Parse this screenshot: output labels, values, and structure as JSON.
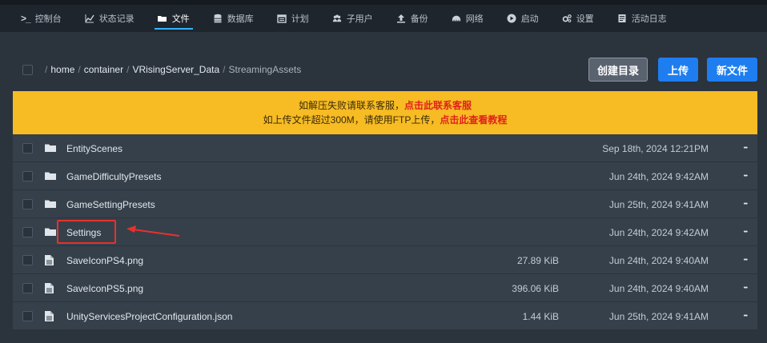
{
  "nav": {
    "tabs": [
      {
        "label": "控制台",
        "icon": "terminal-icon",
        "active": false
      },
      {
        "label": "状态记录",
        "icon": "chart-line-icon",
        "active": false
      },
      {
        "label": "文件",
        "icon": "folder-open-icon",
        "active": true
      },
      {
        "label": "数据库",
        "icon": "database-icon",
        "active": false
      },
      {
        "label": "计划",
        "icon": "calendar-icon",
        "active": false
      },
      {
        "label": "子用户",
        "icon": "users-icon",
        "active": false
      },
      {
        "label": "备份",
        "icon": "upload-icon",
        "active": false
      },
      {
        "label": "网络",
        "icon": "network-icon",
        "active": false
      },
      {
        "label": "启动",
        "icon": "play-circle-icon",
        "active": false
      },
      {
        "label": "设置",
        "icon": "gears-icon",
        "active": false
      },
      {
        "label": "活动日志",
        "icon": "log-icon",
        "active": false
      }
    ]
  },
  "breadcrumb": {
    "segments": [
      "home",
      "container",
      "VRisingServer_Data",
      "StreamingAssets"
    ]
  },
  "toolbar": {
    "mkdir_label": "创建目录",
    "upload_label": "上传",
    "newfile_label": "新文件"
  },
  "notice": {
    "line1_prefix": "如解压失败请联系客服，",
    "line1_link": "点击此联系客服",
    "line2_prefix": "如上传文件超过300M，请使用FTP上传，",
    "line2_link": "点击此查看教程"
  },
  "files": [
    {
      "name": "EntityScenes",
      "type": "folder",
      "size": "",
      "date": "Sep 18th, 2024 12:21PM"
    },
    {
      "name": "GameDifficultyPresets",
      "type": "folder",
      "size": "",
      "date": "Jun 24th, 2024 9:42AM"
    },
    {
      "name": "GameSettingPresets",
      "type": "folder",
      "size": "",
      "date": "Jun 25th, 2024 9:41AM"
    },
    {
      "name": "Settings",
      "type": "folder",
      "size": "",
      "date": "Jun 24th, 2024 9:42AM",
      "highlighted": true
    },
    {
      "name": "SaveIconPS4.png",
      "type": "file",
      "size": "27.89 KiB",
      "date": "Jun 24th, 2024 9:40AM"
    },
    {
      "name": "SaveIconPS5.png",
      "type": "file",
      "size": "396.06 KiB",
      "date": "Jun 24th, 2024 9:40AM"
    },
    {
      "name": "UnityServicesProjectConfiguration.json",
      "type": "file",
      "size": "1.44 KiB",
      "date": "Jun 25th, 2024 9:41AM"
    }
  ],
  "colors": {
    "accent": "#1e7ef0",
    "notice_bg": "#f7bb24",
    "notice_link": "#e0221b",
    "highlight": "#e8322b"
  }
}
